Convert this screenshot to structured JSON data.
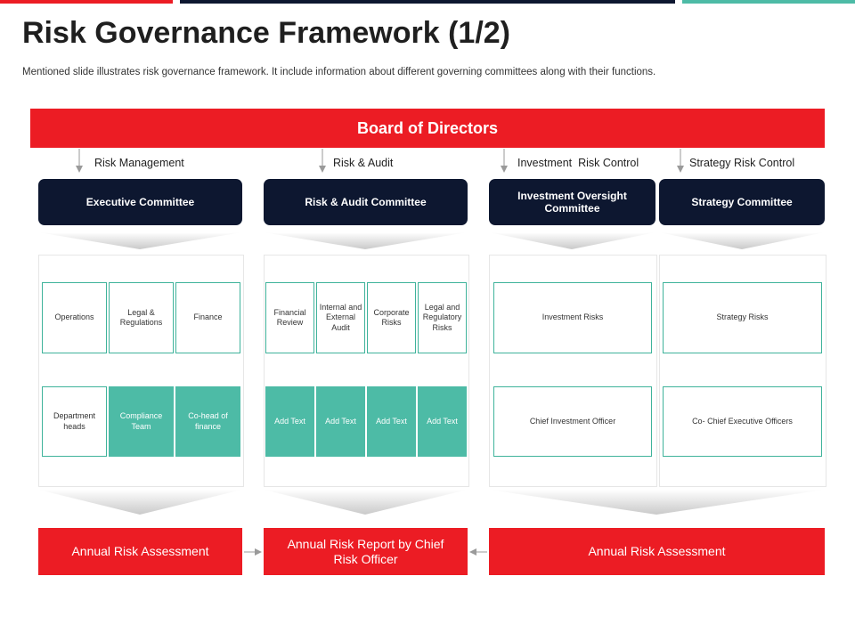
{
  "title": "Risk Governance Framework (1/2)",
  "subtitle": "Mentioned slide illustrates risk governance framework. It include information about different governing committees along with their functions.",
  "colors": {
    "red": "#ec1c24",
    "navy": "#0d1730",
    "teal": "#4dbba6"
  },
  "board": "Board of Directors",
  "branches": [
    "Risk Management",
    "Risk & Audit",
    "Investment  Risk Control",
    "Strategy Risk Control"
  ],
  "committees": [
    "Executive Committee",
    "Risk & Audit Committee",
    "Investment Oversight Committee",
    "Strategy Committee"
  ],
  "executive": {
    "top": [
      "Operations",
      "Legal & Regulations",
      "Finance"
    ],
    "bottom": [
      "Department heads",
      "Compliance Team",
      "Co-head of finance"
    ]
  },
  "audit": {
    "top": [
      "Financial Review",
      "Internal and External Audit",
      "Corporate Risks",
      "Legal and Regulatory Risks"
    ],
    "bottom": [
      "Add Text",
      "Add Text",
      "Add Text",
      "Add Text"
    ]
  },
  "investment": {
    "top": "Investment Risks",
    "bottom": "Chief Investment Officer"
  },
  "strategy": {
    "top": "Strategy Risks",
    "bottom": "Co- Chief Executive Officers"
  },
  "outputs": [
    "Annual Risk Assessment",
    "Annual Risk Report by Chief Risk Officer",
    "Annual Risk Assessment"
  ]
}
